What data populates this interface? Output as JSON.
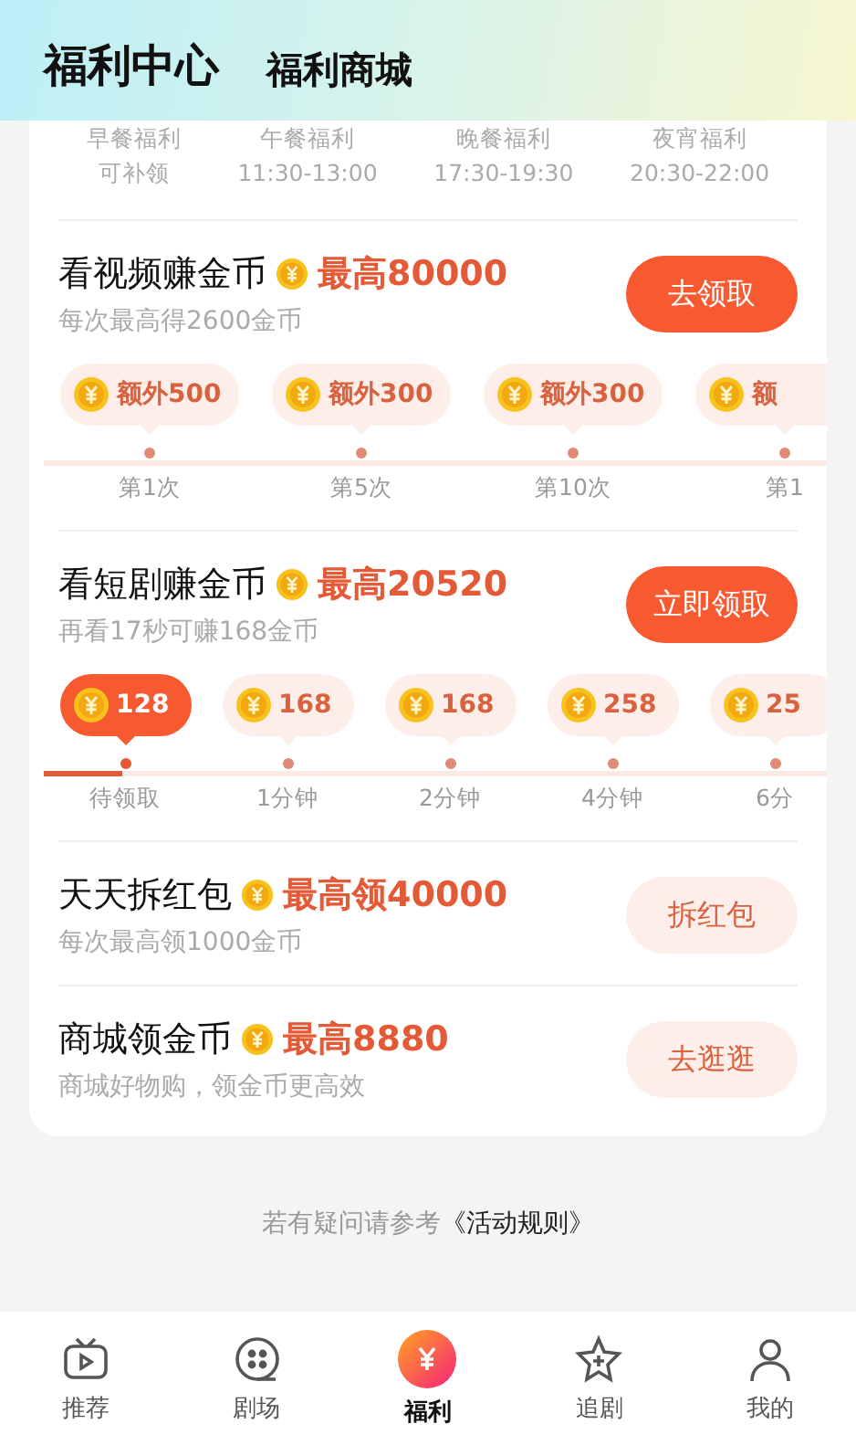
{
  "header": {
    "tabs": [
      {
        "label": "福利中心",
        "selected": true
      },
      {
        "label": "福利商城",
        "selected": false
      }
    ]
  },
  "meals": [
    {
      "name": "早餐福利",
      "time": "可补领"
    },
    {
      "name": "午餐福利",
      "time": "11:30-13:00"
    },
    {
      "name": "晚餐福利",
      "time": "17:30-19:30"
    },
    {
      "name": "夜宵福利",
      "time": "20:30-22:00"
    }
  ],
  "tasks": [
    {
      "kind": "timeline",
      "title": "看视频赚金币",
      "reward": "最高80000",
      "subtitle": "每次最高得2600金币",
      "button": {
        "label": "去领取",
        "primary": true
      },
      "timeline": {
        "steps": [
          {
            "amount": "额外500",
            "label": "第1次",
            "selected": false
          },
          {
            "amount": "额外300",
            "label": "第5次",
            "selected": false
          },
          {
            "amount": "额外300",
            "label": "第10次",
            "selected": false
          },
          {
            "amount": "额",
            "label": "第1",
            "selected": false
          }
        ]
      }
    },
    {
      "kind": "timeline",
      "title": "看短剧赚金币",
      "reward": "最高20520",
      "subtitle": "再看17秒可赚168金币",
      "button": {
        "label": "立即领取",
        "primary": true
      },
      "timeline": {
        "level": 0.1,
        "steps": [
          {
            "amount": "128",
            "label": "待领取",
            "selected": true
          },
          {
            "amount": "168",
            "label": "1分钟",
            "selected": false
          },
          {
            "amount": "168",
            "label": "2分钟",
            "selected": false
          },
          {
            "amount": "258",
            "label": "4分钟",
            "selected": false
          },
          {
            "amount": "25",
            "label": "6分",
            "selected": false
          }
        ]
      }
    },
    {
      "kind": "simple",
      "title": "天天拆红包",
      "reward": "最高领40000",
      "subtitle": "每次最高领1000金币",
      "button": {
        "label": "拆红包",
        "primary": false
      }
    },
    {
      "kind": "simple",
      "title": "商城领金币",
      "reward": "最高8880",
      "subtitle": "商城好物购，领金币更高效",
      "button": {
        "label": "去逛逛",
        "primary": false
      }
    }
  ],
  "footer": {
    "text": "若有疑问请参考",
    "link": "《活动规则》"
  },
  "tabbar": [
    {
      "label": "推荐",
      "selected": false
    },
    {
      "label": "剧场",
      "selected": false
    },
    {
      "label": "福利",
      "selected": true
    },
    {
      "label": "追剧",
      "selected": false
    },
    {
      "label": "我的",
      "selected": false
    }
  ]
}
